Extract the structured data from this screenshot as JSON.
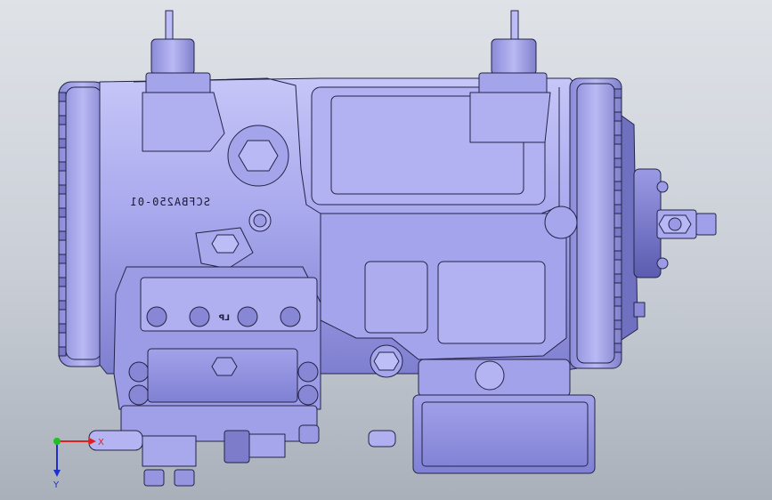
{
  "model": {
    "part_marking": "SCFBA250-01",
    "port_label": "LP",
    "body_color": "#a8a8ef",
    "edge_color": "#232348"
  },
  "triad": {
    "x_label": "X",
    "y_label": "Y",
    "x_color": "#e02020",
    "y_color": "#20c020",
    "z_color": "#2030d0"
  }
}
